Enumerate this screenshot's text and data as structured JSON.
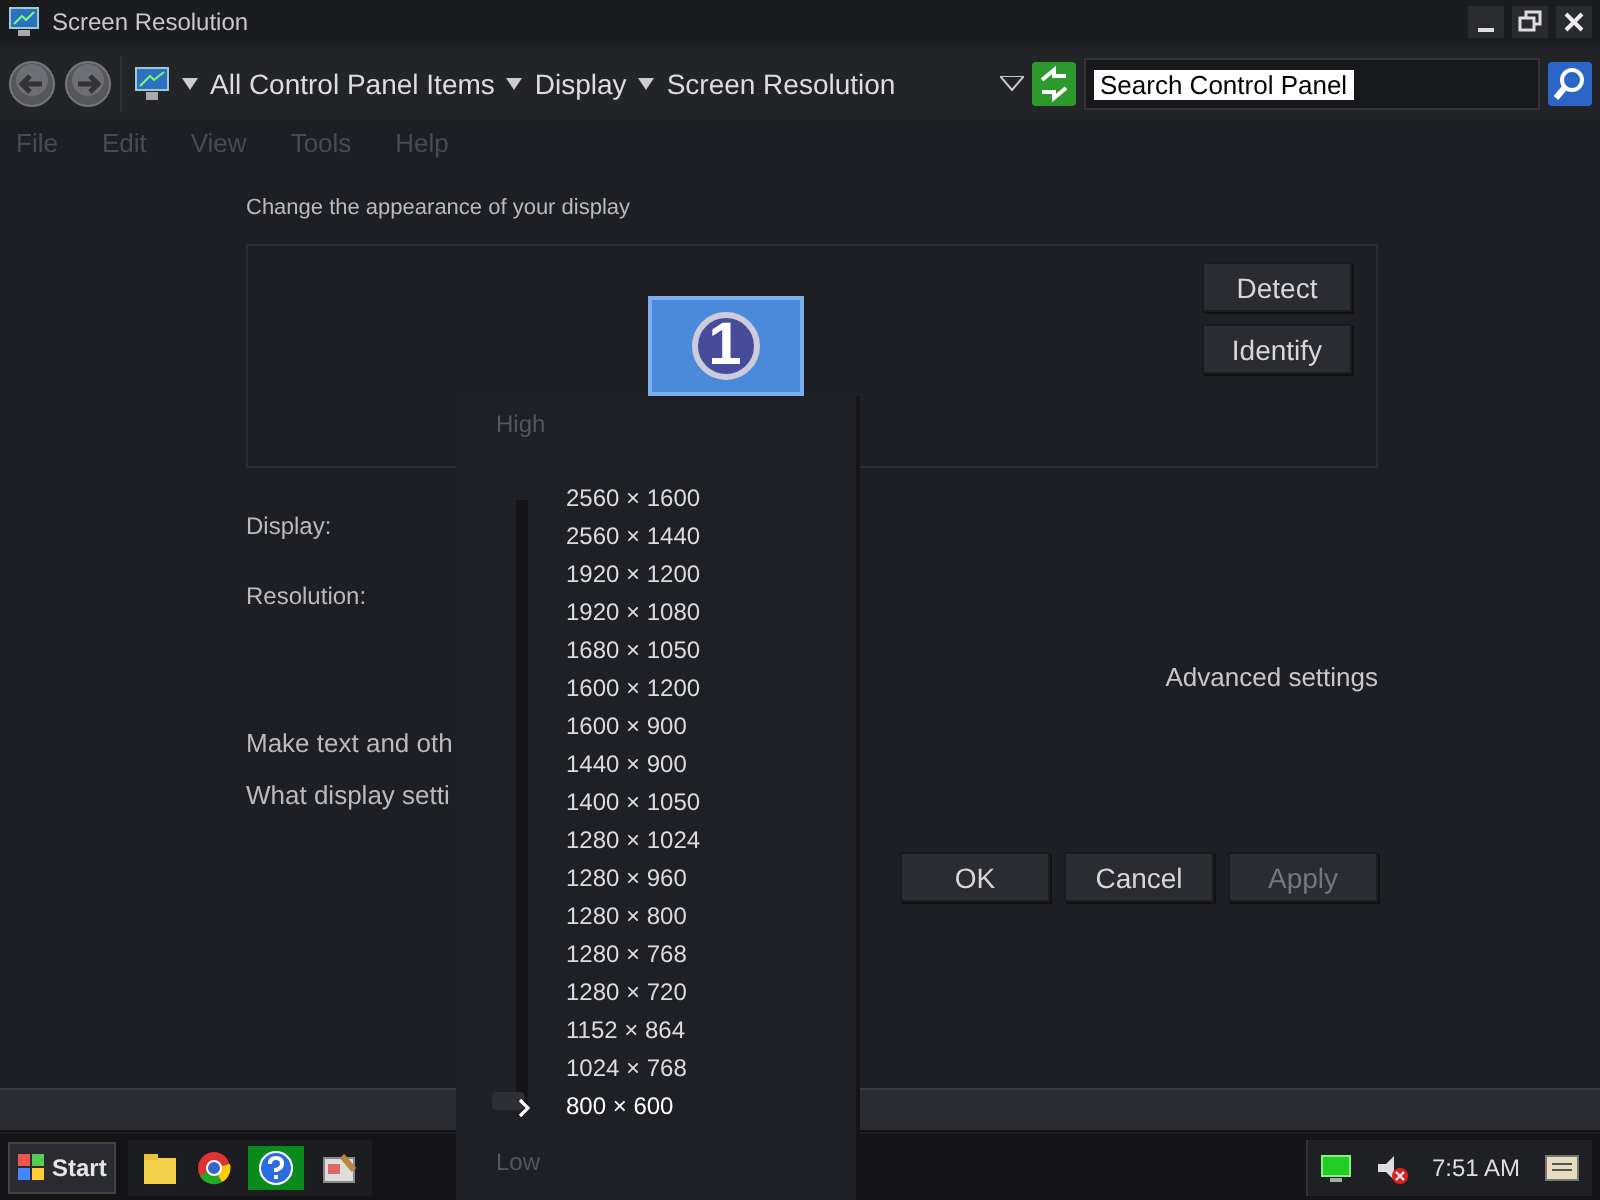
{
  "window": {
    "title": "Screen Resolution"
  },
  "address_bar": {
    "breadcrumbs": [
      "All Control Panel Items",
      "Display",
      "Screen Resolution"
    ]
  },
  "search": {
    "value": "Search Control Panel"
  },
  "menu": [
    {
      "label": "File",
      "disabled": true
    },
    {
      "label": "Edit",
      "disabled": true
    },
    {
      "label": "View",
      "disabled": true
    },
    {
      "label": "Tools",
      "disabled": true
    },
    {
      "label": "Help",
      "disabled": true
    }
  ],
  "heading": "Change the appearance of your display",
  "monitor": {
    "number": "1"
  },
  "monitor_buttons": [
    "Detect",
    "Identify"
  ],
  "fields": [
    {
      "label": "Display:"
    },
    {
      "label": "Resolution:"
    }
  ],
  "advanced_link": "Advanced settings",
  "links": [
    "Make text and oth",
    "What display setti"
  ],
  "buttons": [
    {
      "label": "OK",
      "disabled": false
    },
    {
      "label": "Cancel",
      "disabled": false
    },
    {
      "label": "Apply",
      "disabled": true
    }
  ],
  "resolution_popup": {
    "high_label": "High",
    "low_label": "Low",
    "slider": {
      "level": 0
    },
    "options": [
      {
        "label": "2560 × 1600",
        "selected": false
      },
      {
        "label": "2560 × 1440",
        "selected": false
      },
      {
        "label": "1920 × 1200",
        "selected": false
      },
      {
        "label": "1920 × 1080",
        "selected": false
      },
      {
        "label": "1680 × 1050",
        "selected": false
      },
      {
        "label": "1600 × 1200",
        "selected": false
      },
      {
        "label": "1600 × 900",
        "selected": false
      },
      {
        "label": "1440 × 900",
        "selected": false
      },
      {
        "label": "1400 × 1050",
        "selected": false
      },
      {
        "label": "1280 × 1024",
        "selected": false
      },
      {
        "label": "1280 × 960",
        "selected": false
      },
      {
        "label": "1280 × 800",
        "selected": false
      },
      {
        "label": "1280 × 768",
        "selected": false
      },
      {
        "label": "1280 × 720",
        "selected": false
      },
      {
        "label": "1152 × 864",
        "selected": false
      },
      {
        "label": "1024 × 768",
        "selected": false
      },
      {
        "label": "800 × 600",
        "selected": true
      }
    ]
  },
  "taskbar": {
    "start": "Start",
    "clock": "7:51 AM"
  }
}
